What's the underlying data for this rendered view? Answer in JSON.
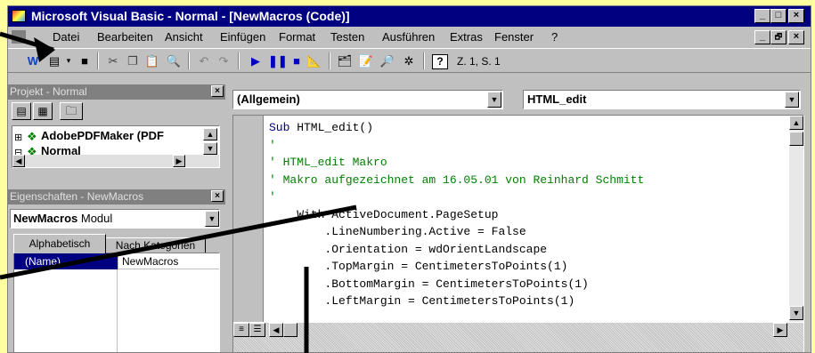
{
  "window": {
    "title": "Microsoft Visual Basic - Normal - [NewMacros (Code)]",
    "minimize": "_",
    "maximize": "□",
    "close": "×",
    "child_min": "_",
    "child_restore": "🗗",
    "child_close": "×"
  },
  "menu": {
    "items": [
      "Datei",
      "Bearbeiten",
      "Ansicht",
      "Einfügen",
      "Format",
      "Testen",
      "Ausführen",
      "Extras",
      "Fenster",
      "?"
    ]
  },
  "toolbar": {
    "position": "Z. 1, S. 1"
  },
  "project": {
    "title": "Projekt - Normal",
    "items": [
      "AdobePDFMaker (PDF",
      "Normal"
    ]
  },
  "properties": {
    "title": "Eigenschaften - NewMacros",
    "object_name": "NewMacros",
    "object_type": "Modul",
    "tabs": [
      "Alphabetisch",
      "Nach Kategorien"
    ],
    "rows": [
      {
        "name": "(Name)",
        "value": "NewMacros"
      }
    ]
  },
  "editor": {
    "object_combo": "(Allgemein)",
    "proc_combo": "HTML_edit",
    "lines": [
      {
        "type": "kw",
        "text": "Sub HTML_edit()"
      },
      {
        "type": "cm",
        "text": "'"
      },
      {
        "type": "cm",
        "text": "' HTML_edit Makro"
      },
      {
        "type": "cm",
        "text": "' Makro aufgezeichnet am 16.05.01 von Reinhard Schmitt"
      },
      {
        "type": "cm",
        "text": "'"
      },
      {
        "type": "plain",
        "text": "    With ActiveDocument.PageSetup"
      },
      {
        "type": "plain",
        "text": "        .LineNumbering.Active = False"
      },
      {
        "type": "plain",
        "text": "        .Orientation = wdOrientLandscape"
      },
      {
        "type": "plain",
        "text": "        .TopMargin = CentimetersToPoints(1)"
      },
      {
        "type": "plain",
        "text": "        .BottomMargin = CentimetersToPoints(1)"
      },
      {
        "type": "plain",
        "text": "        .LeftMargin = CentimetersToPoints(1)"
      }
    ]
  },
  "colors": {
    "page_background": "#ffffa0",
    "titlebar": "#000080",
    "keyword": "#000080",
    "comment": "#008000"
  }
}
